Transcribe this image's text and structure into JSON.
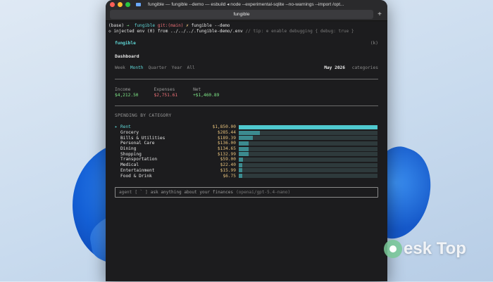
{
  "window": {
    "title": "fungible — fungible --demo — esbuild ◂ node --experimental-sqlite --no-warnings --import /opt...",
    "tab_label": "fungible",
    "new_tab_symbol": "+"
  },
  "terminal": {
    "prompt_env": "(base)",
    "prompt_arrow": "→",
    "prompt_dir": "fungible",
    "prompt_git": "git:(main)",
    "prompt_x": "✗",
    "command": "fungible --demo",
    "env_line_prefix": "◇",
    "env_line": "injected env (0) from ../../../.fungible-demo/.env",
    "env_tip": "// tip: ⊕ enable debugging { debug: true }"
  },
  "app": {
    "name": "fungible",
    "shortcut": "(k)",
    "view_title": "Dashboard",
    "periods": [
      "Week",
      "Month",
      "Quarter",
      "Year",
      "All"
    ],
    "active_period": "Month",
    "current_month": "May 2026",
    "categories_link": "categories",
    "summary": {
      "income_label": "Income",
      "income_value": "$4,212.50",
      "expenses_label": "Expenses",
      "expenses_value": "$2,751.61",
      "net_label": "Net",
      "net_value": "+$1,460.89"
    },
    "spending_title": "SPENDING BY CATEGORY",
    "selected_marker": "▸",
    "categories": [
      {
        "name": "Rent",
        "amount": "$1,850.00",
        "value": 1850.0,
        "selected": true
      },
      {
        "name": "Grocery",
        "amount": "$285.44",
        "value": 285.44,
        "selected": false
      },
      {
        "name": "Bills & Utilities",
        "amount": "$189.39",
        "value": 189.39,
        "selected": false
      },
      {
        "name": "Personal Care",
        "amount": "$136.00",
        "value": 136.0,
        "selected": false
      },
      {
        "name": "Dining",
        "amount": "$134.65",
        "value": 134.65,
        "selected": false
      },
      {
        "name": "Shopping",
        "amount": "$132.99",
        "value": 132.99,
        "selected": false
      },
      {
        "name": "Transportation",
        "amount": "$59.00",
        "value": 59.0,
        "selected": false
      },
      {
        "name": "Medical",
        "amount": "$22.40",
        "value": 22.4,
        "selected": false
      },
      {
        "name": "Entertainment",
        "amount": "$15.99",
        "value": 15.99,
        "selected": false
      },
      {
        "name": "Food & Drink",
        "amount": "$6.75",
        "value": 6.75,
        "selected": false
      }
    ],
    "agent": {
      "label": "agent",
      "bracket": "[ ` ]",
      "placeholder": "ask anything about your finances",
      "model": "(openai/gpt-5.4-nano)"
    }
  },
  "watermark": {
    "text": "esk Top",
    "logo": "D"
  },
  "colors": {
    "accent": "#5fd7d7",
    "income": "#7ee787",
    "expense": "#f07178",
    "amount": "#e5c07b",
    "bar": "#3c8b8f"
  }
}
